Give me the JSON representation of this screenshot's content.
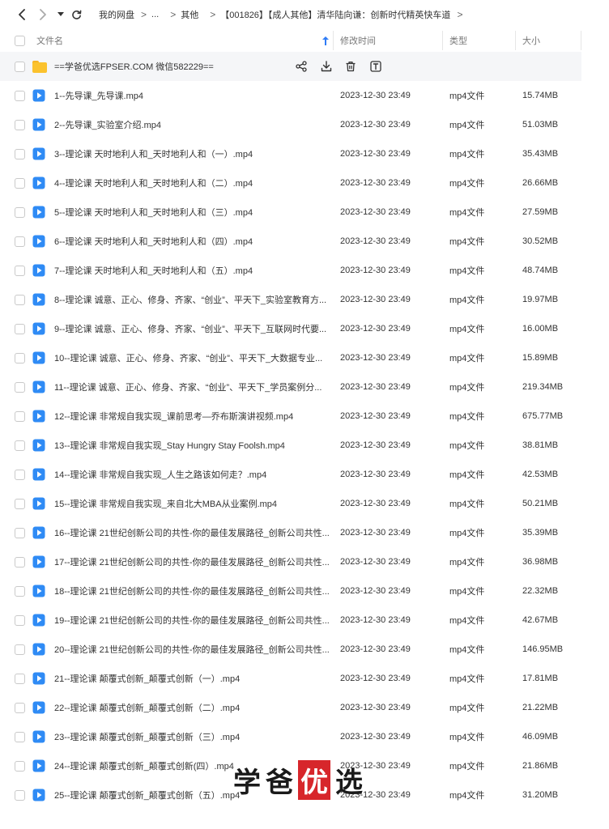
{
  "breadcrumb": {
    "items": [
      "我的网盘",
      "...",
      "其他",
      "【001826】【成人其他】清华陆向谦：创新时代精英快车道"
    ],
    "separator": ">"
  },
  "columns": {
    "name": "文件名",
    "modified": "修改时间",
    "type": "类型",
    "size": "大小"
  },
  "folder": {
    "name": "==学爸优选FPSER.COM 微信582229=="
  },
  "files": [
    {
      "name": "1--先导课_先导课.mp4",
      "date": "2023-12-30 23:49",
      "type": "mp4文件",
      "size": "15.74MB"
    },
    {
      "name": "2--先导课_实验室介绍.mp4",
      "date": "2023-12-30 23:49",
      "type": "mp4文件",
      "size": "51.03MB"
    },
    {
      "name": "3--理论课 天时地利人和_天时地利人和（一）.mp4",
      "date": "2023-12-30 23:49",
      "type": "mp4文件",
      "size": "35.43MB"
    },
    {
      "name": "4--理论课 天时地利人和_天时地利人和（二）.mp4",
      "date": "2023-12-30 23:49",
      "type": "mp4文件",
      "size": "26.66MB"
    },
    {
      "name": "5--理论课 天时地利人和_天时地利人和（三）.mp4",
      "date": "2023-12-30 23:49",
      "type": "mp4文件",
      "size": "27.59MB"
    },
    {
      "name": "6--理论课 天时地利人和_天时地利人和（四）.mp4",
      "date": "2023-12-30 23:49",
      "type": "mp4文件",
      "size": "30.52MB"
    },
    {
      "name": "7--理论课 天时地利人和_天时地利人和（五）.mp4",
      "date": "2023-12-30 23:49",
      "type": "mp4文件",
      "size": "48.74MB"
    },
    {
      "name": "8--理论课 诚意、正心、修身、齐家、“创业”、平天下_实验室教育方...",
      "date": "2023-12-30 23:49",
      "type": "mp4文件",
      "size": "19.97MB"
    },
    {
      "name": "9--理论课 诚意、正心、修身、齐家、“创业”、平天下_互联网时代要...",
      "date": "2023-12-30 23:49",
      "type": "mp4文件",
      "size": "16.00MB"
    },
    {
      "name": "10--理论课 诚意、正心、修身、齐家、“创业”、平天下_大数据专业...",
      "date": "2023-12-30 23:49",
      "type": "mp4文件",
      "size": "15.89MB"
    },
    {
      "name": "11--理论课 诚意、正心、修身、齐家、“创业”、平天下_学员案例分...",
      "date": "2023-12-30 23:49",
      "type": "mp4文件",
      "size": "219.34MB"
    },
    {
      "name": "12--理论课 非常规自我实现_课前思考—乔布斯演讲视频.mp4",
      "date": "2023-12-30 23:49",
      "type": "mp4文件",
      "size": "675.77MB"
    },
    {
      "name": "13--理论课 非常规自我实现_Stay Hungry Stay Foolsh.mp4",
      "date": "2023-12-30 23:49",
      "type": "mp4文件",
      "size": "38.81MB"
    },
    {
      "name": "14--理论课 非常规自我实现_人生之路该如何走？.mp4",
      "date": "2023-12-30 23:49",
      "type": "mp4文件",
      "size": "42.53MB"
    },
    {
      "name": "15--理论课 非常规自我实现_来自北大MBA从业案例.mp4",
      "date": "2023-12-30 23:49",
      "type": "mp4文件",
      "size": "50.21MB"
    },
    {
      "name": "16--理论课 21世纪创新公司的共性-你的最佳发展路径_创新公司共性...",
      "date": "2023-12-30 23:49",
      "type": "mp4文件",
      "size": "35.39MB"
    },
    {
      "name": "17--理论课 21世纪创新公司的共性-你的最佳发展路径_创新公司共性...",
      "date": "2023-12-30 23:49",
      "type": "mp4文件",
      "size": "36.98MB"
    },
    {
      "name": "18--理论课 21世纪创新公司的共性-你的最佳发展路径_创新公司共性...",
      "date": "2023-12-30 23:49",
      "type": "mp4文件",
      "size": "22.32MB"
    },
    {
      "name": "19--理论课 21世纪创新公司的共性-你的最佳发展路径_创新公司共性...",
      "date": "2023-12-30 23:49",
      "type": "mp4文件",
      "size": "42.67MB"
    },
    {
      "name": "20--理论课 21世纪创新公司的共性-你的最佳发展路径_创新公司共性...",
      "date": "2023-12-30 23:49",
      "type": "mp4文件",
      "size": "146.95MB"
    },
    {
      "name": "21--理论课 颠覆式创新_颠覆式创新（一）.mp4",
      "date": "2023-12-30 23:49",
      "type": "mp4文件",
      "size": "17.81MB"
    },
    {
      "name": "22--理论课 颠覆式创新_颠覆式创新（二）.mp4",
      "date": "2023-12-30 23:49",
      "type": "mp4文件",
      "size": "21.22MB"
    },
    {
      "name": "23--理论课 颠覆式创新_颠覆式创新（三）.mp4",
      "date": "2023-12-30 23:49",
      "type": "mp4文件",
      "size": "46.09MB"
    },
    {
      "name": "24--理论课 颠覆式创新_颠覆式创新(四）.mp4",
      "date": "2023-12-30 23:49",
      "type": "mp4文件",
      "size": "21.86MB"
    },
    {
      "name": "25--理论课 颠覆式创新_颠覆式创新（五）.mp4",
      "date": "2023-12-30 23:49",
      "type": "mp4文件",
      "size": "31.20MB"
    }
  ],
  "watermark": {
    "part1": "学爸",
    "highlight": "优",
    "part2": "选"
  },
  "colors": {
    "accent": "#2f7cf6",
    "folder": "#fbc22d",
    "video": "#2f8bf5",
    "watermark_highlight": "#d7262b"
  }
}
